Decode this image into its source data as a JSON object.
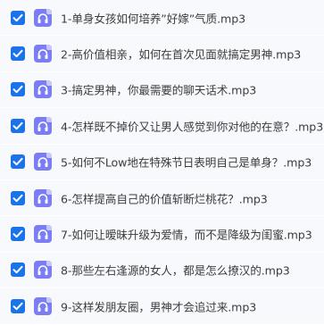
{
  "files": [
    {
      "name": "1-单身女孩如何培养”好嫁”气质.mp3",
      "checked": true,
      "icon": "audio-file-icon"
    },
    {
      "name": "2-高价值相亲，如何在首次见面就搞定男神.mp3",
      "checked": true,
      "icon": "audio-file-icon"
    },
    {
      "name": "3-搞定男神，你最需要的聊天话术.mp3",
      "checked": true,
      "icon": "audio-file-icon"
    },
    {
      "name": "4-怎样既不掉价又让男人感觉到你对他的在意？.mp3",
      "checked": true,
      "icon": "audio-file-icon"
    },
    {
      "name": "5-如何不Low地在特殊节日表明自己是单身？.mp3",
      "checked": true,
      "icon": "audio-file-icon"
    },
    {
      "name": "6-怎样提高自己的价值斩断烂桃花？.mp3",
      "checked": true,
      "icon": "audio-file-icon"
    },
    {
      "name": "7-如何让暧昧升级为爱情，而不是降级为闺蜜.mp3",
      "checked": true,
      "icon": "audio-file-icon"
    },
    {
      "name": "8-那些左右逢源的女人，都是怎么撩汉的.mp3",
      "checked": true,
      "icon": "audio-file-icon"
    },
    {
      "name": "9-这样发朋友圈，男神才会追过来.mp3",
      "checked": true,
      "icon": "audio-file-icon"
    }
  ],
  "colors": {
    "checkbox": "#1a73e8",
    "file_icon": "#7b7df5",
    "row_bg": "#f7f9fc"
  }
}
